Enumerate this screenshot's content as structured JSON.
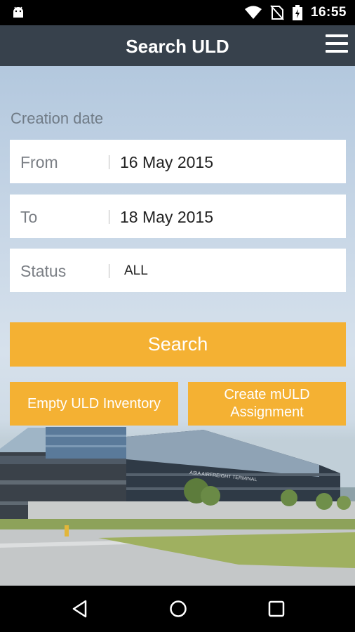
{
  "status_bar": {
    "time": "16:55",
    "icons": [
      "android-icon",
      "wifi-icon",
      "no-sim-icon",
      "battery-charging-icon"
    ]
  },
  "app_bar": {
    "title": "Search ULD",
    "menu_icon": "hamburger-menu-icon",
    "background": "#37414c"
  },
  "form": {
    "section_label": "Creation date",
    "from": {
      "label": "From",
      "value": "16 May 2015"
    },
    "to": {
      "label": "To",
      "value": "18 May 2015"
    },
    "status": {
      "label": "Status",
      "value": "ALL"
    }
  },
  "buttons": {
    "search": "Search",
    "empty_inventory": "Empty ULD Inventory",
    "create_assignment_line1": "Create mULD",
    "create_assignment_line2": "Assignment",
    "color": "#f4b133"
  },
  "building_sign": "ASIA AIRFREIGHT TERMINAL",
  "nav_bar": {
    "icons": [
      "back-icon",
      "home-icon",
      "recents-icon"
    ]
  }
}
